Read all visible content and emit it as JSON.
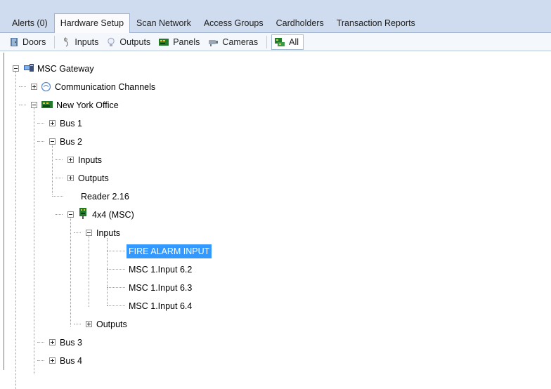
{
  "tabs": [
    {
      "label": "Alerts (0)"
    },
    {
      "label": "Hardware Setup",
      "active": true
    },
    {
      "label": "Scan Network"
    },
    {
      "label": "Access Groups"
    },
    {
      "label": "Cardholders"
    },
    {
      "label": "Transaction Reports"
    }
  ],
  "toolbar": {
    "doors": "Doors",
    "inputs": "Inputs",
    "outputs": "Outputs",
    "panels": "Panels",
    "cameras": "Cameras",
    "all": "All"
  },
  "tree": {
    "root": "MSC Gateway",
    "comm_channels": "Communication Channels",
    "site": "New York Office",
    "bus1": "Bus 1",
    "bus2": "Bus 2",
    "bus2_inputs": "Inputs",
    "bus2_outputs": "Outputs",
    "reader": "Reader 2.16",
    "board": "4x4 (MSC)",
    "board_inputs": "Inputs",
    "input_items": [
      "FIRE ALARM INPUT",
      "MSC 1.Input 6.2",
      "MSC 1.Input 6.3",
      "MSC 1.Input 6.4"
    ],
    "board_outputs": "Outputs",
    "bus3": "Bus 3",
    "bus4": "Bus 4"
  },
  "colors": {
    "selection": "#3399ff",
    "tab_strip": "#cfdcef"
  },
  "icons": [
    "door-icon",
    "input-icon",
    "bulb-icon",
    "panel-icon",
    "camera-icon",
    "all-icon",
    "gateway-icon",
    "channels-icon",
    "site-panel-icon",
    "board-icon"
  ]
}
